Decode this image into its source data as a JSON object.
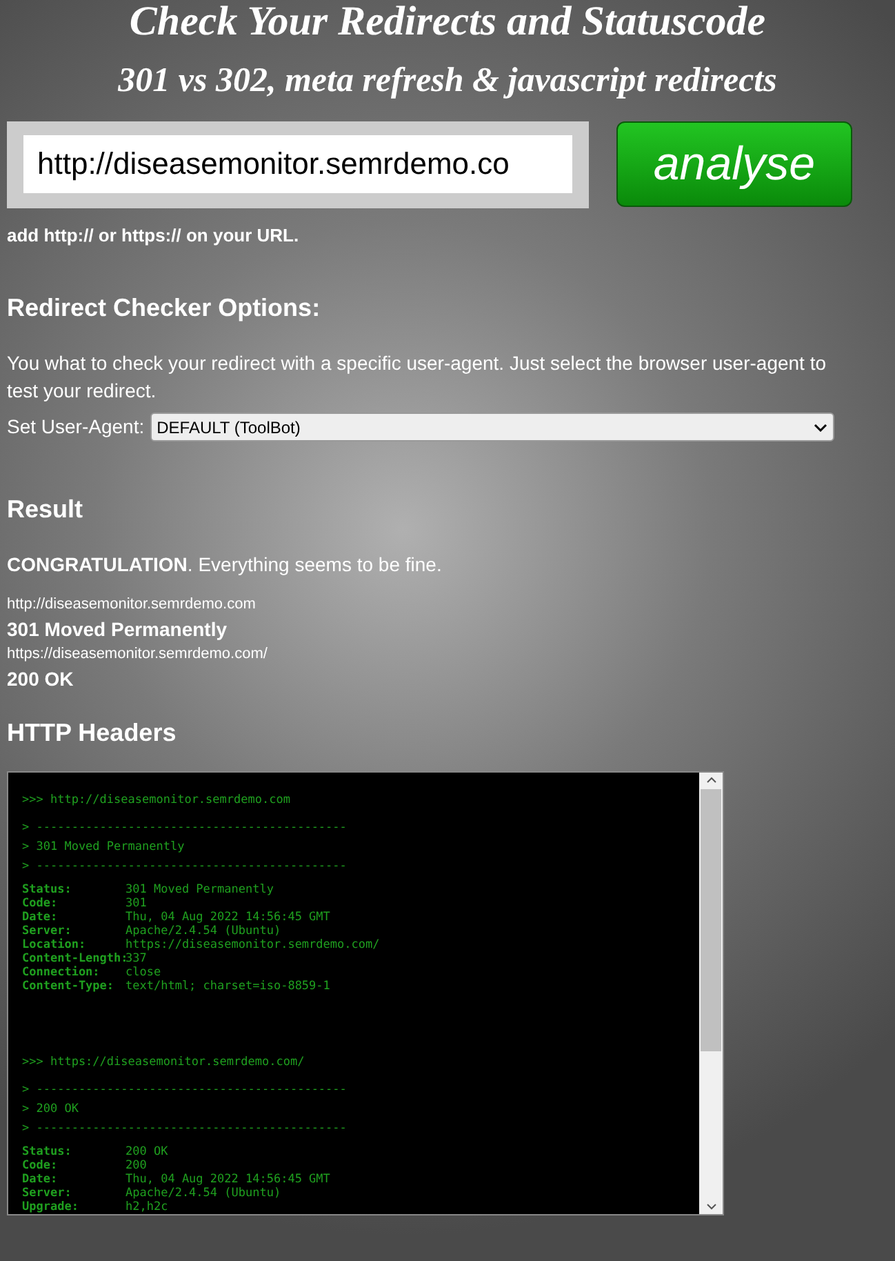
{
  "title": "Check Your Redirects and Statuscode",
  "subtitle": "301 vs 302, meta refresh & javascript redirects",
  "url_field": {
    "value": "http://diseasemonitor.semrdemo.co"
  },
  "analyse_button": "analyse",
  "hint": "add http:// or https:// on your URL.",
  "options": {
    "heading": "Redirect Checker Options:",
    "text": "You what to check your redirect with a specific user-agent. Just select the browser user-agent to test your redirect.",
    "select_label": "Set User-Agent:",
    "select_value": "DEFAULT (ToolBot)"
  },
  "result": {
    "heading": "Result",
    "message": "**CONGRATULATION**. Everything seems to be fine.",
    "hops": [
      {
        "url": "http://diseasemonitor.semrdemo.com",
        "status": "301 Moved Permanently"
      },
      {
        "url": "https://diseasemonitor.semrdemo.com/",
        "status": "200 OK"
      }
    ]
  },
  "headers": {
    "heading": "HTTP Headers",
    "blocks": [
      {
        "url": ">>> http://diseasemonitor.semrdemo.com",
        "separator_top": "> --------------------------------------------",
        "status_line": "> 301 Moved Permanently",
        "separator_bottom": "> --------------------------------------------",
        "fields": [
          {
            "key": "Status:",
            "value": "301 Moved Permanently"
          },
          {
            "key": "Code:",
            "value": "301"
          },
          {
            "key": "Date:",
            "value": "Thu, 04 Aug 2022 14:56:45 GMT"
          },
          {
            "key": "Server:",
            "value": "Apache/2.4.54 (Ubuntu)"
          },
          {
            "key": "Location:",
            "value": "https://diseasemonitor.semrdemo.com/"
          },
          {
            "key": "Content-Length:",
            "value": "337"
          },
          {
            "key": "Connection:",
            "value": "close"
          },
          {
            "key": "Content-Type:",
            "value": "text/html; charset=iso-8859-1"
          }
        ]
      },
      {
        "url": ">>> https://diseasemonitor.semrdemo.com/",
        "separator_top": "> --------------------------------------------",
        "status_line": "> 200 OK",
        "separator_bottom": "> --------------------------------------------",
        "fields": [
          {
            "key": "Status:",
            "value": "200 OK"
          },
          {
            "key": "Code:",
            "value": "200"
          },
          {
            "key": "Date:",
            "value": "Thu, 04 Aug 2022 14:56:45 GMT"
          },
          {
            "key": "Server:",
            "value": "Apache/2.4.54 (Ubuntu)"
          },
          {
            "key": "Upgrade:",
            "value": "h2,h2c"
          }
        ]
      }
    ]
  }
}
